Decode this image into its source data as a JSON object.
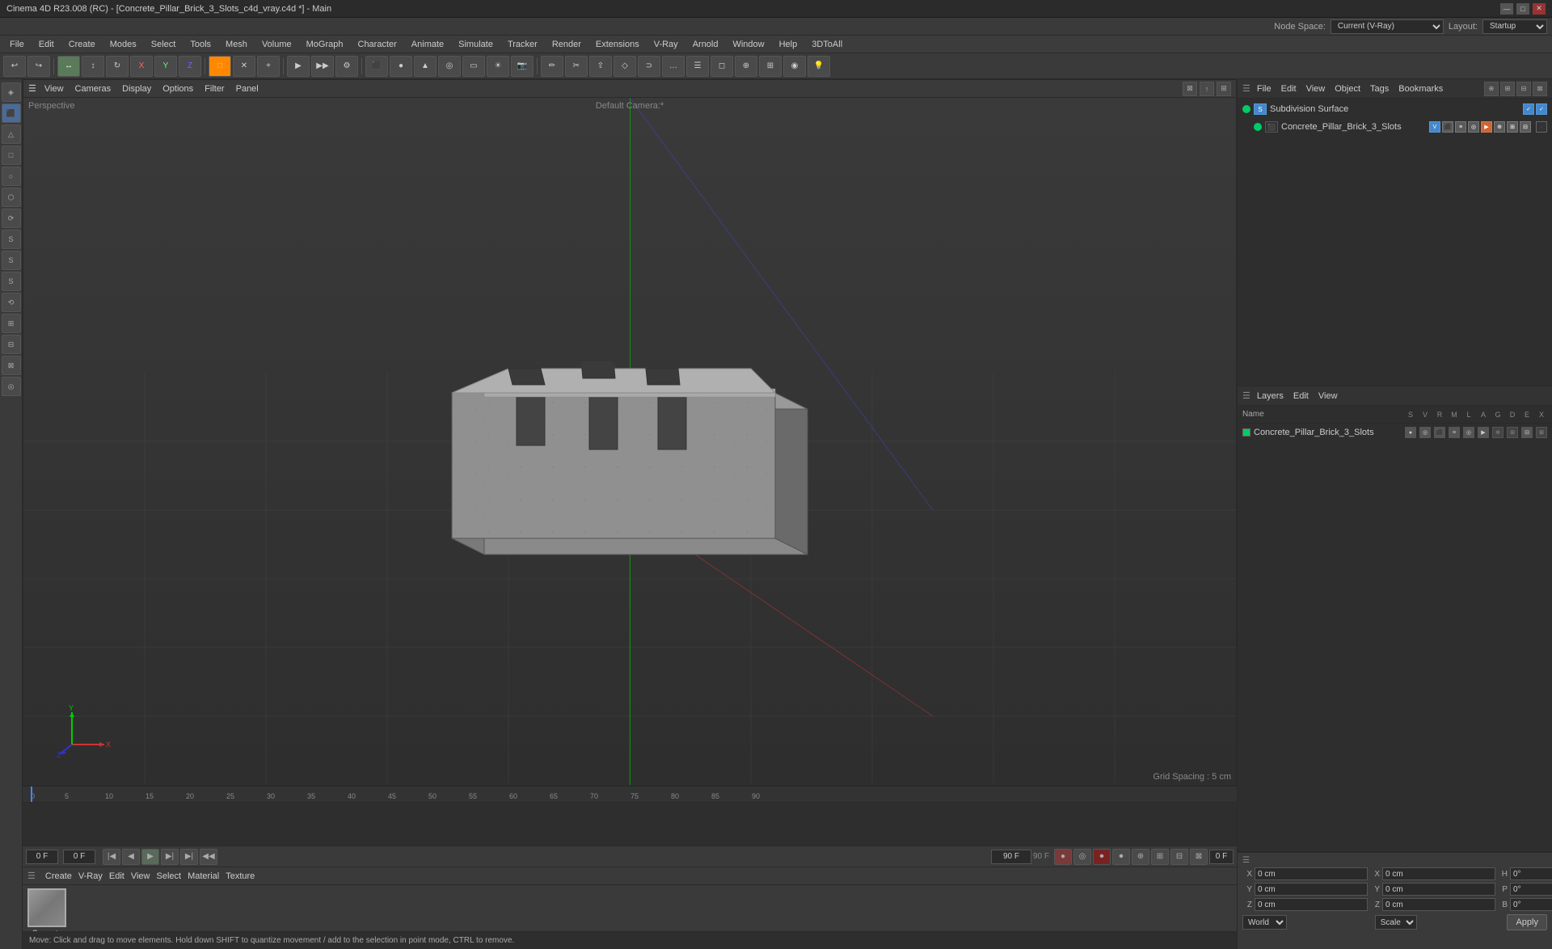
{
  "titleBar": {
    "title": "Cinema 4D R23.008 (RC) - [Concrete_Pillar_Brick_3_Slots_c4d_vray.c4d *] - Main",
    "minimize": "—",
    "maximize": "□",
    "close": "✕"
  },
  "menuBar": {
    "items": [
      "File",
      "Edit",
      "Create",
      "Modes",
      "Select",
      "Tools",
      "Mesh",
      "Volume",
      "MoGraph",
      "Character",
      "Animate",
      "Simulate",
      "Tracker",
      "Render",
      "Extensions",
      "V-Ray",
      "Arnold",
      "Window",
      "Help",
      "3DToAll"
    ]
  },
  "nodeSpace": {
    "label": "Node Space:",
    "value": "Current (V-Ray)",
    "layoutLabel": "Layout:",
    "layoutValue": "Startup"
  },
  "viewport": {
    "menus": [
      "View",
      "Cameras",
      "Display",
      "Options",
      "Filter",
      "Panel"
    ],
    "cameraLabel": "Perspective",
    "cameraName": "Default Camera:*",
    "gridSpacing": "Grid Spacing : 5 cm"
  },
  "objectManager": {
    "menus": [
      "File",
      "Edit",
      "View",
      "Object",
      "Tags",
      "Bookmarks"
    ],
    "objects": [
      {
        "name": "Subdivision Surface",
        "indent": 0,
        "hasCheck": true,
        "color": "#00cc66"
      },
      {
        "name": "Concrete_Pillar_Brick_3_Slots",
        "indent": 1,
        "hasCheck": false,
        "color": "#00cc66"
      }
    ]
  },
  "layers": {
    "menus": [
      "Layers",
      "Edit",
      "View"
    ],
    "columns": {
      "name": "Name",
      "flags": [
        "S",
        "V",
        "R",
        "M",
        "L",
        "A",
        "G",
        "D",
        "E",
        "X"
      ]
    },
    "items": [
      {
        "name": "Concrete_Pillar_Brick_3_Slots",
        "color": "#00cc66"
      }
    ]
  },
  "coordinates": {
    "x": {
      "pos": "0 cm",
      "size": "0 cm"
    },
    "y": {
      "pos": "0 cm",
      "size": "0 cm"
    },
    "z": {
      "pos": "0 cm",
      "size": "0 cm"
    },
    "rotation": {
      "h": "0°",
      "p": "0°",
      "b": "0°"
    },
    "worldLabel": "World",
    "scaleLabel": "Scale",
    "applyLabel": "Apply"
  },
  "timeline": {
    "startFrame": "0 F",
    "endFrame": "90 F",
    "currentFrame": "0 F",
    "endInput": "90 F",
    "ticks": [
      "0",
      "5",
      "10",
      "15",
      "20",
      "25",
      "30",
      "35",
      "40",
      "45",
      "50",
      "55",
      "60",
      "65",
      "70",
      "75",
      "80",
      "85",
      "90"
    ]
  },
  "materialArea": {
    "menus": [
      "Create",
      "V-Ray",
      "Edit",
      "View",
      "Select",
      "Material",
      "Texture"
    ],
    "materials": [
      {
        "name": "Concrete",
        "color": "#888888"
      }
    ]
  },
  "statusBar": {
    "text": "Move: Click and drag to move elements. Hold down SHIFT to quantize movement / add to the selection in point mode, CTRL to remove."
  },
  "sideTools": {
    "tools": [
      "◉",
      "⊕",
      "△",
      "□",
      "○",
      "⬡",
      "⟳",
      "S",
      "S",
      "S",
      "⟲",
      "⊞",
      "⊟",
      "⊠",
      "◎"
    ]
  }
}
